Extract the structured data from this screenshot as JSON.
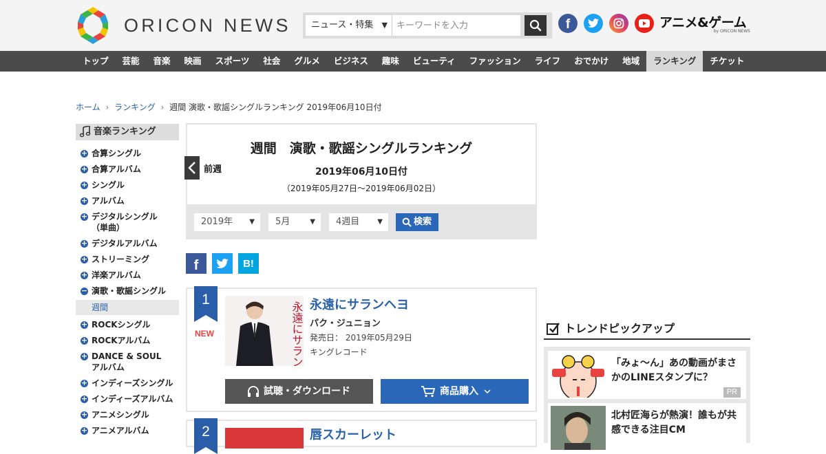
{
  "header": {
    "logo_text": "ORICON NEWS",
    "search": {
      "category": "ニュース・特集",
      "placeholder": "キーワードを入力"
    },
    "social": [
      "facebook-icon",
      "twitter-icon",
      "instagram-icon",
      "youtube-icon"
    ],
    "anime_logo": "アニメ&ゲーム",
    "anime_logo_sub": "by ORICON NEWS"
  },
  "nav": {
    "items": [
      "トップ",
      "芸能",
      "音楽",
      "映画",
      "スポーツ",
      "社会",
      "グルメ",
      "ビジネス",
      "趣味",
      "ビューティ",
      "ファッション",
      "ライフ",
      "おでかけ",
      "地域",
      "ランキング",
      "チケット"
    ],
    "active": "ランキング"
  },
  "breadcrumb": {
    "home": "ホーム",
    "ranking": "ランキング",
    "current": "週間 演歌・歌謡シングルランキング 2019年06月10日付"
  },
  "sidebar": {
    "title": "音楽ランキング",
    "items": [
      {
        "label": "合算シングル",
        "open": false
      },
      {
        "label": "合算アルバム",
        "open": false
      },
      {
        "label": "シングル",
        "open": false
      },
      {
        "label": "アルバム",
        "open": false
      },
      {
        "label": "デジタルシングル\n（単曲）",
        "open": false
      },
      {
        "label": "デジタルアルバム",
        "open": false
      },
      {
        "label": "ストリーミング",
        "open": false
      },
      {
        "label": "洋楽アルバム",
        "open": false
      },
      {
        "label": "演歌・歌謡シングル",
        "open": true,
        "sub": "週間"
      },
      {
        "label": "ROCKシングル",
        "open": false
      },
      {
        "label": "ROCKアルバム",
        "open": false
      },
      {
        "label": "DANCE & SOUL\nアルバム",
        "open": false
      },
      {
        "label": "インディーズシングル",
        "open": false
      },
      {
        "label": "インディーズアルバム",
        "open": false
      },
      {
        "label": "アニメシングル",
        "open": false
      },
      {
        "label": "アニメアルバム",
        "open": false
      }
    ]
  },
  "ranking": {
    "title": "週間　演歌・歌謡シングルランキング",
    "date": "2019年06月10日付",
    "range": "（2019年05月27日～2019年06月02日）",
    "prev_label": "前週",
    "filters": {
      "year": "2019年",
      "month": "5月",
      "week": "4週目"
    },
    "search_label": "検索"
  },
  "share": {
    "facebook": "f",
    "hatena": "B!"
  },
  "entries": [
    {
      "rank": "1",
      "badge": "NEW",
      "title": "永遠にサランヘヨ",
      "artist": "パク・ジュニョン",
      "release_label": "発売日：",
      "release_date": "2019年05月29日",
      "label": "キングレコード",
      "jacket_title": "永遠にサランヘヨ",
      "download_label": "試聴・ダウンロード",
      "buy_label": "商品購入"
    },
    {
      "rank": "2",
      "title": "唇スカーレット"
    }
  ],
  "trend": {
    "title": "トレンドピックアップ",
    "items": [
      {
        "text": "「みょ～ん」あの動画がまさかのLINEスタンプに？",
        "badge": "PR"
      },
      {
        "text": "北村匠海らが熱演！誰もが共感できる注目CM"
      }
    ]
  },
  "colors": {
    "nav_bg": "#4b4b4b",
    "link": "#2a62a8",
    "accent_blue": "#2a67b8",
    "new_red": "#e8443f"
  }
}
